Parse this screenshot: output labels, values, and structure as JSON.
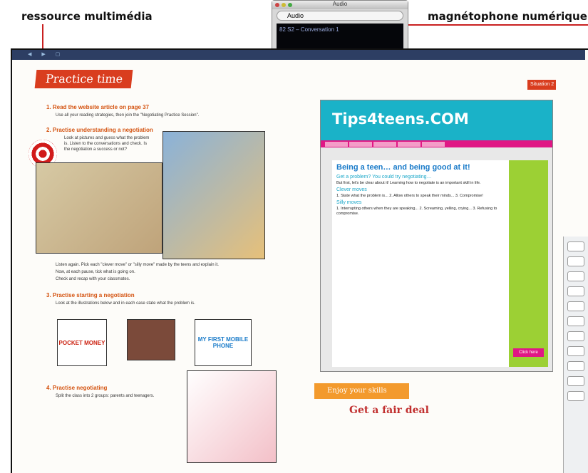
{
  "callouts": {
    "left": "ressource multimédia",
    "right": "magnétophone numérique"
  },
  "audio_window": {
    "title": "Audio",
    "field_label": "Audio",
    "track": "82 S2 – Conversation 1"
  },
  "book": {
    "title": "Practice time",
    "situation_label": "Situation",
    "situation_number": "2",
    "sections": [
      {
        "label": "1. Read the website article on page 37",
        "text": "Use all your reading strategies, then join the \"Negotiating Practice Session\"."
      },
      {
        "label": "2. Practise understanding a negotiation",
        "text": "Look at pictures and guess what the problem is. Listen to the conversations and check. Is the negotiation a success or not?"
      },
      {
        "label": "3. Practise starting a negotiation",
        "text": "Look at the illustrations below and in each case state what the problem is."
      },
      {
        "label": "4. Practise negotiating",
        "text": "Split the class into 2 groups: parents and teenagers."
      }
    ],
    "extra_text": [
      "Listen again. Pick each \"clever move\" or \"silly move\" made by the teens and explain it.",
      "Now, at each pause, tick what is going on.",
      "Check and recap with your classmates."
    ]
  },
  "browser": {
    "site_title": "Tips4teens.COM",
    "headline": "Being a teen… and being good at it!",
    "subhead": "Get a problem? You could try negotiating…",
    "clever_moves": "Clever moves",
    "silly_moves": "Silly moves",
    "sidebar_cta": "Click here"
  },
  "enjoy": {
    "label": "Enjoy your skills",
    "subtitle": "Get a fair deal"
  },
  "illustration_texts": {
    "pocket_money": "POCKET MONEY",
    "mobile_phone": "MY FIRST MOBILE PHONE"
  }
}
